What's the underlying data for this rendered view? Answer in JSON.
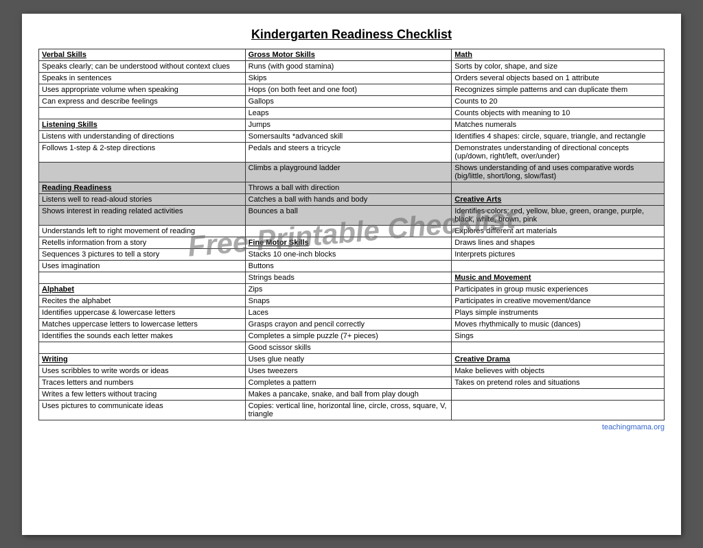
{
  "title": "Kindergarten Readiness Checklist",
  "watermark": "Free Printable Checklist",
  "attribution": "teachingmama.org",
  "table": {
    "headers": [
      "Verbal Skills",
      "Gross Motor Skills",
      "Math"
    ],
    "rows": [
      {
        "col1": {
          "text": "Speaks clearly; can be understood without context clues",
          "type": "data"
        },
        "col2": {
          "text": "Runs (with good stamina)",
          "type": "data"
        },
        "col3": {
          "text": "Sorts by color, shape, and size",
          "type": "data"
        }
      },
      {
        "col1": {
          "text": "Speaks in sentences",
          "type": "data"
        },
        "col2": {
          "text": "Skips",
          "type": "data"
        },
        "col3": {
          "text": "Orders several objects based on 1 attribute",
          "type": "data"
        }
      },
      {
        "col1": {
          "text": "Uses appropriate volume when speaking",
          "type": "data"
        },
        "col2": {
          "text": "Hops (on both feet and one foot)",
          "type": "data"
        },
        "col3": {
          "text": "Recognizes simple patterns and can duplicate them",
          "type": "data"
        }
      },
      {
        "col1": {
          "text": "Can express and describe feelings",
          "type": "data"
        },
        "col2": {
          "text": "Gallops",
          "type": "data"
        },
        "col3": {
          "text": "Counts to 20",
          "type": "data"
        }
      },
      {
        "col1": {
          "text": "",
          "type": "data"
        },
        "col2": {
          "text": "Leaps",
          "type": "data"
        },
        "col3": {
          "text": "Counts objects with meaning to 10",
          "type": "data"
        }
      },
      {
        "col1": {
          "text": "Listening Skills",
          "type": "header"
        },
        "col2": {
          "text": "Jumps",
          "type": "data"
        },
        "col3": {
          "text": "Matches numerals",
          "type": "data"
        }
      },
      {
        "col1": {
          "text": "Listens with understanding of directions",
          "type": "data"
        },
        "col2": {
          "text": "Somersaults   *advanced skill",
          "type": "data"
        },
        "col3": {
          "text": "Identifies 4 shapes: circle, square, triangle, and rectangle",
          "type": "data"
        }
      },
      {
        "col1": {
          "text": "Follows 1-step & 2-step directions",
          "type": "data"
        },
        "col2": {
          "text": "Pedals and steers a tricycle",
          "type": "data"
        },
        "col3": {
          "text": "Demonstrates understanding of directional concepts (up/down, right/left, over/under)",
          "type": "data"
        }
      },
      {
        "col1": {
          "text": "",
          "type": "data"
        },
        "col2": {
          "text": "Climbs a playground ladder",
          "type": "data"
        },
        "col3": {
          "text": "Shows understanding of and uses comparative words (big/little, short/long, slow/fast)",
          "type": "data"
        },
        "highlight": true
      },
      {
        "col1": {
          "text": "Reading Readiness",
          "type": "header"
        },
        "col2": {
          "text": "Throws a ball with direction",
          "type": "data"
        },
        "col3": {
          "text": "",
          "type": "data"
        },
        "highlight": true
      },
      {
        "col1": {
          "text": "Listens well to read-aloud stories",
          "type": "data"
        },
        "col2": {
          "text": "Catches a ball with hands and body",
          "type": "data"
        },
        "col3": {
          "text": "Creative Arts",
          "type": "header"
        },
        "highlight": true
      },
      {
        "col1": {
          "text": "Shows interest in reading related activities",
          "type": "data"
        },
        "col2": {
          "text": "Bounces a ball",
          "type": "data"
        },
        "col3": {
          "text": "Identifies colors: red, yellow, blue, green, orange, purple, black, white, brown, pink",
          "type": "data"
        },
        "highlight": true
      },
      {
        "col1": {
          "text": "Understands left to right movement of reading",
          "type": "data"
        },
        "col2": {
          "text": "",
          "type": "data"
        },
        "col3": {
          "text": "Explores different art materials",
          "type": "data"
        }
      },
      {
        "col1": {
          "text": "Retells information from a story",
          "type": "data"
        },
        "col2": {
          "text": "Fine Motor Skills",
          "type": "header"
        },
        "col3": {
          "text": "Draws lines and shapes",
          "type": "data"
        }
      },
      {
        "col1": {
          "text": "Sequences 3 pictures to tell a story",
          "type": "data"
        },
        "col2": {
          "text": "Stacks 10 one-inch blocks",
          "type": "data"
        },
        "col3": {
          "text": "Interprets pictures",
          "type": "data"
        }
      },
      {
        "col1": {
          "text": "Uses imagination",
          "type": "data"
        },
        "col2": {
          "text": "Buttons",
          "type": "data"
        },
        "col3": {
          "text": "",
          "type": "data"
        }
      },
      {
        "col1": {
          "text": "",
          "type": "data"
        },
        "col2": {
          "text": "Strings beads",
          "type": "data"
        },
        "col3": {
          "text": "Music and Movement",
          "type": "header"
        }
      },
      {
        "col1": {
          "text": "Alphabet",
          "type": "header"
        },
        "col2": {
          "text": "Zips",
          "type": "data"
        },
        "col3": {
          "text": "Participates in group music experiences",
          "type": "data"
        }
      },
      {
        "col1": {
          "text": "Recites the alphabet",
          "type": "data"
        },
        "col2": {
          "text": "Snaps",
          "type": "data"
        },
        "col3": {
          "text": "Participates in creative movement/dance",
          "type": "data"
        }
      },
      {
        "col1": {
          "text": "Identifies uppercase & lowercase letters",
          "type": "data"
        },
        "col2": {
          "text": "Laces",
          "type": "data"
        },
        "col3": {
          "text": "Plays simple instruments",
          "type": "data"
        }
      },
      {
        "col1": {
          "text": "Matches uppercase letters to lowercase letters",
          "type": "data"
        },
        "col2": {
          "text": "Grasps crayon and pencil correctly",
          "type": "data"
        },
        "col3": {
          "text": "Moves rhythmically to music (dances)",
          "type": "data"
        }
      },
      {
        "col1": {
          "text": "Identifies the sounds each letter makes",
          "type": "data"
        },
        "col2": {
          "text": "Completes a simple puzzle (7+ pieces)",
          "type": "data"
        },
        "col3": {
          "text": "Sings",
          "type": "data"
        }
      },
      {
        "col1": {
          "text": "",
          "type": "data"
        },
        "col2": {
          "text": "Good scissor skills",
          "type": "data"
        },
        "col3": {
          "text": "",
          "type": "data"
        }
      },
      {
        "col1": {
          "text": "Writing",
          "type": "header"
        },
        "col2": {
          "text": "Uses glue neatly",
          "type": "data"
        },
        "col3": {
          "text": "Creative Drama",
          "type": "header"
        }
      },
      {
        "col1": {
          "text": "Uses scribbles to write words or ideas",
          "type": "data"
        },
        "col2": {
          "text": "Uses tweezers",
          "type": "data"
        },
        "col3": {
          "text": "Make believes with objects",
          "type": "data"
        }
      },
      {
        "col1": {
          "text": "Traces letters and numbers",
          "type": "data"
        },
        "col2": {
          "text": "Completes a pattern",
          "type": "data"
        },
        "col3": {
          "text": "Takes on pretend roles and situations",
          "type": "data"
        }
      },
      {
        "col1": {
          "text": "Writes a few letters without tracing",
          "type": "data"
        },
        "col2": {
          "text": "Makes a pancake, snake, and ball from play dough",
          "type": "data"
        },
        "col3": {
          "text": "",
          "type": "data"
        }
      },
      {
        "col1": {
          "text": "Uses pictures to communicate ideas",
          "type": "data"
        },
        "col2": {
          "text": "Copies: vertical line, horizontal line, circle, cross, square, V, triangle",
          "type": "data"
        },
        "col3": {
          "text": "",
          "type": "data"
        }
      }
    ]
  }
}
